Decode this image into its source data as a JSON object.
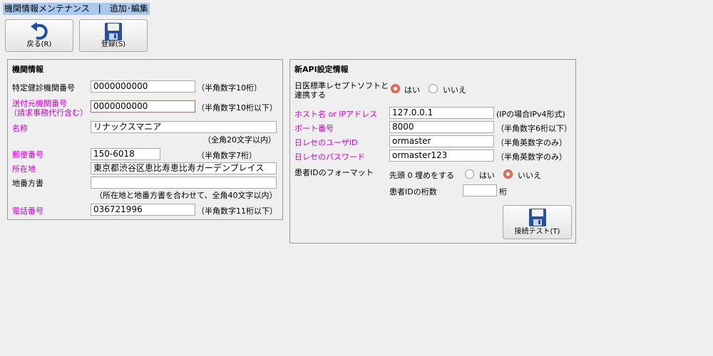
{
  "window": {
    "title": "機関情報メンテナンス　|　追加･編集"
  },
  "toolbar": {
    "back_label": "戻る(R)",
    "save_label": "登録(S)"
  },
  "org_panel": {
    "title": "機関情報",
    "fields": {
      "checkup_no": {
        "label": "特定健診機関番号",
        "value": "0000000000",
        "hint": "（半角数字10桁）"
      },
      "sender_no": {
        "label1": "送付元機関番号",
        "label2": "（請求事務代行含む）",
        "value": "0000000000",
        "hint": "（半角数字10桁以下）"
      },
      "name": {
        "label": "名称",
        "value": "リナックスマニア",
        "hint": "（全角20文字以内）"
      },
      "postal": {
        "label": "郵便番号",
        "value": "150-6018",
        "hint": "（半角数字7桁）"
      },
      "address": {
        "label": "所在地",
        "value": "東京都渋谷区恵比寿恵比寿ガーデンプレイス"
      },
      "lot": {
        "label": "地番方書",
        "value": "",
        "hint": "（所在地と地番方書を合わせて、全角40文字以内）"
      },
      "phone": {
        "label": "電話番号",
        "value": "036721996",
        "hint": "（半角数字11桁以下）"
      }
    }
  },
  "api_panel": {
    "title": "新API設定情報",
    "link_label1": "日医標準レセプトソフトと",
    "link_label2": "連携する",
    "link_yes": "はい",
    "link_no": "いいえ",
    "host": {
      "label": "ホスト名 or IPアドレス",
      "value": "127.0.0.1",
      "hint": "(IPの場合IPv4形式)"
    },
    "port": {
      "label": "ポート番号",
      "value": "8000",
      "hint": "（半角数字6桁以下）"
    },
    "user": {
      "label": "日レセのユーザID",
      "value": "ormaster",
      "hint": "（半角英数字のみ）"
    },
    "password": {
      "label": "日レセのパスワード",
      "value": "ormaster123",
      "hint": "（半角英数字のみ）"
    },
    "patient_format": {
      "label": "患者IDのフォーマット",
      "zero_fill_label": "先頭 0 埋めをする",
      "yes": "はい",
      "no": "いいえ",
      "digits_label": "患者IDの桁数",
      "digits_value": "",
      "digits_unit": "桁"
    },
    "connect_test_label": "接続テスト(T)"
  }
}
